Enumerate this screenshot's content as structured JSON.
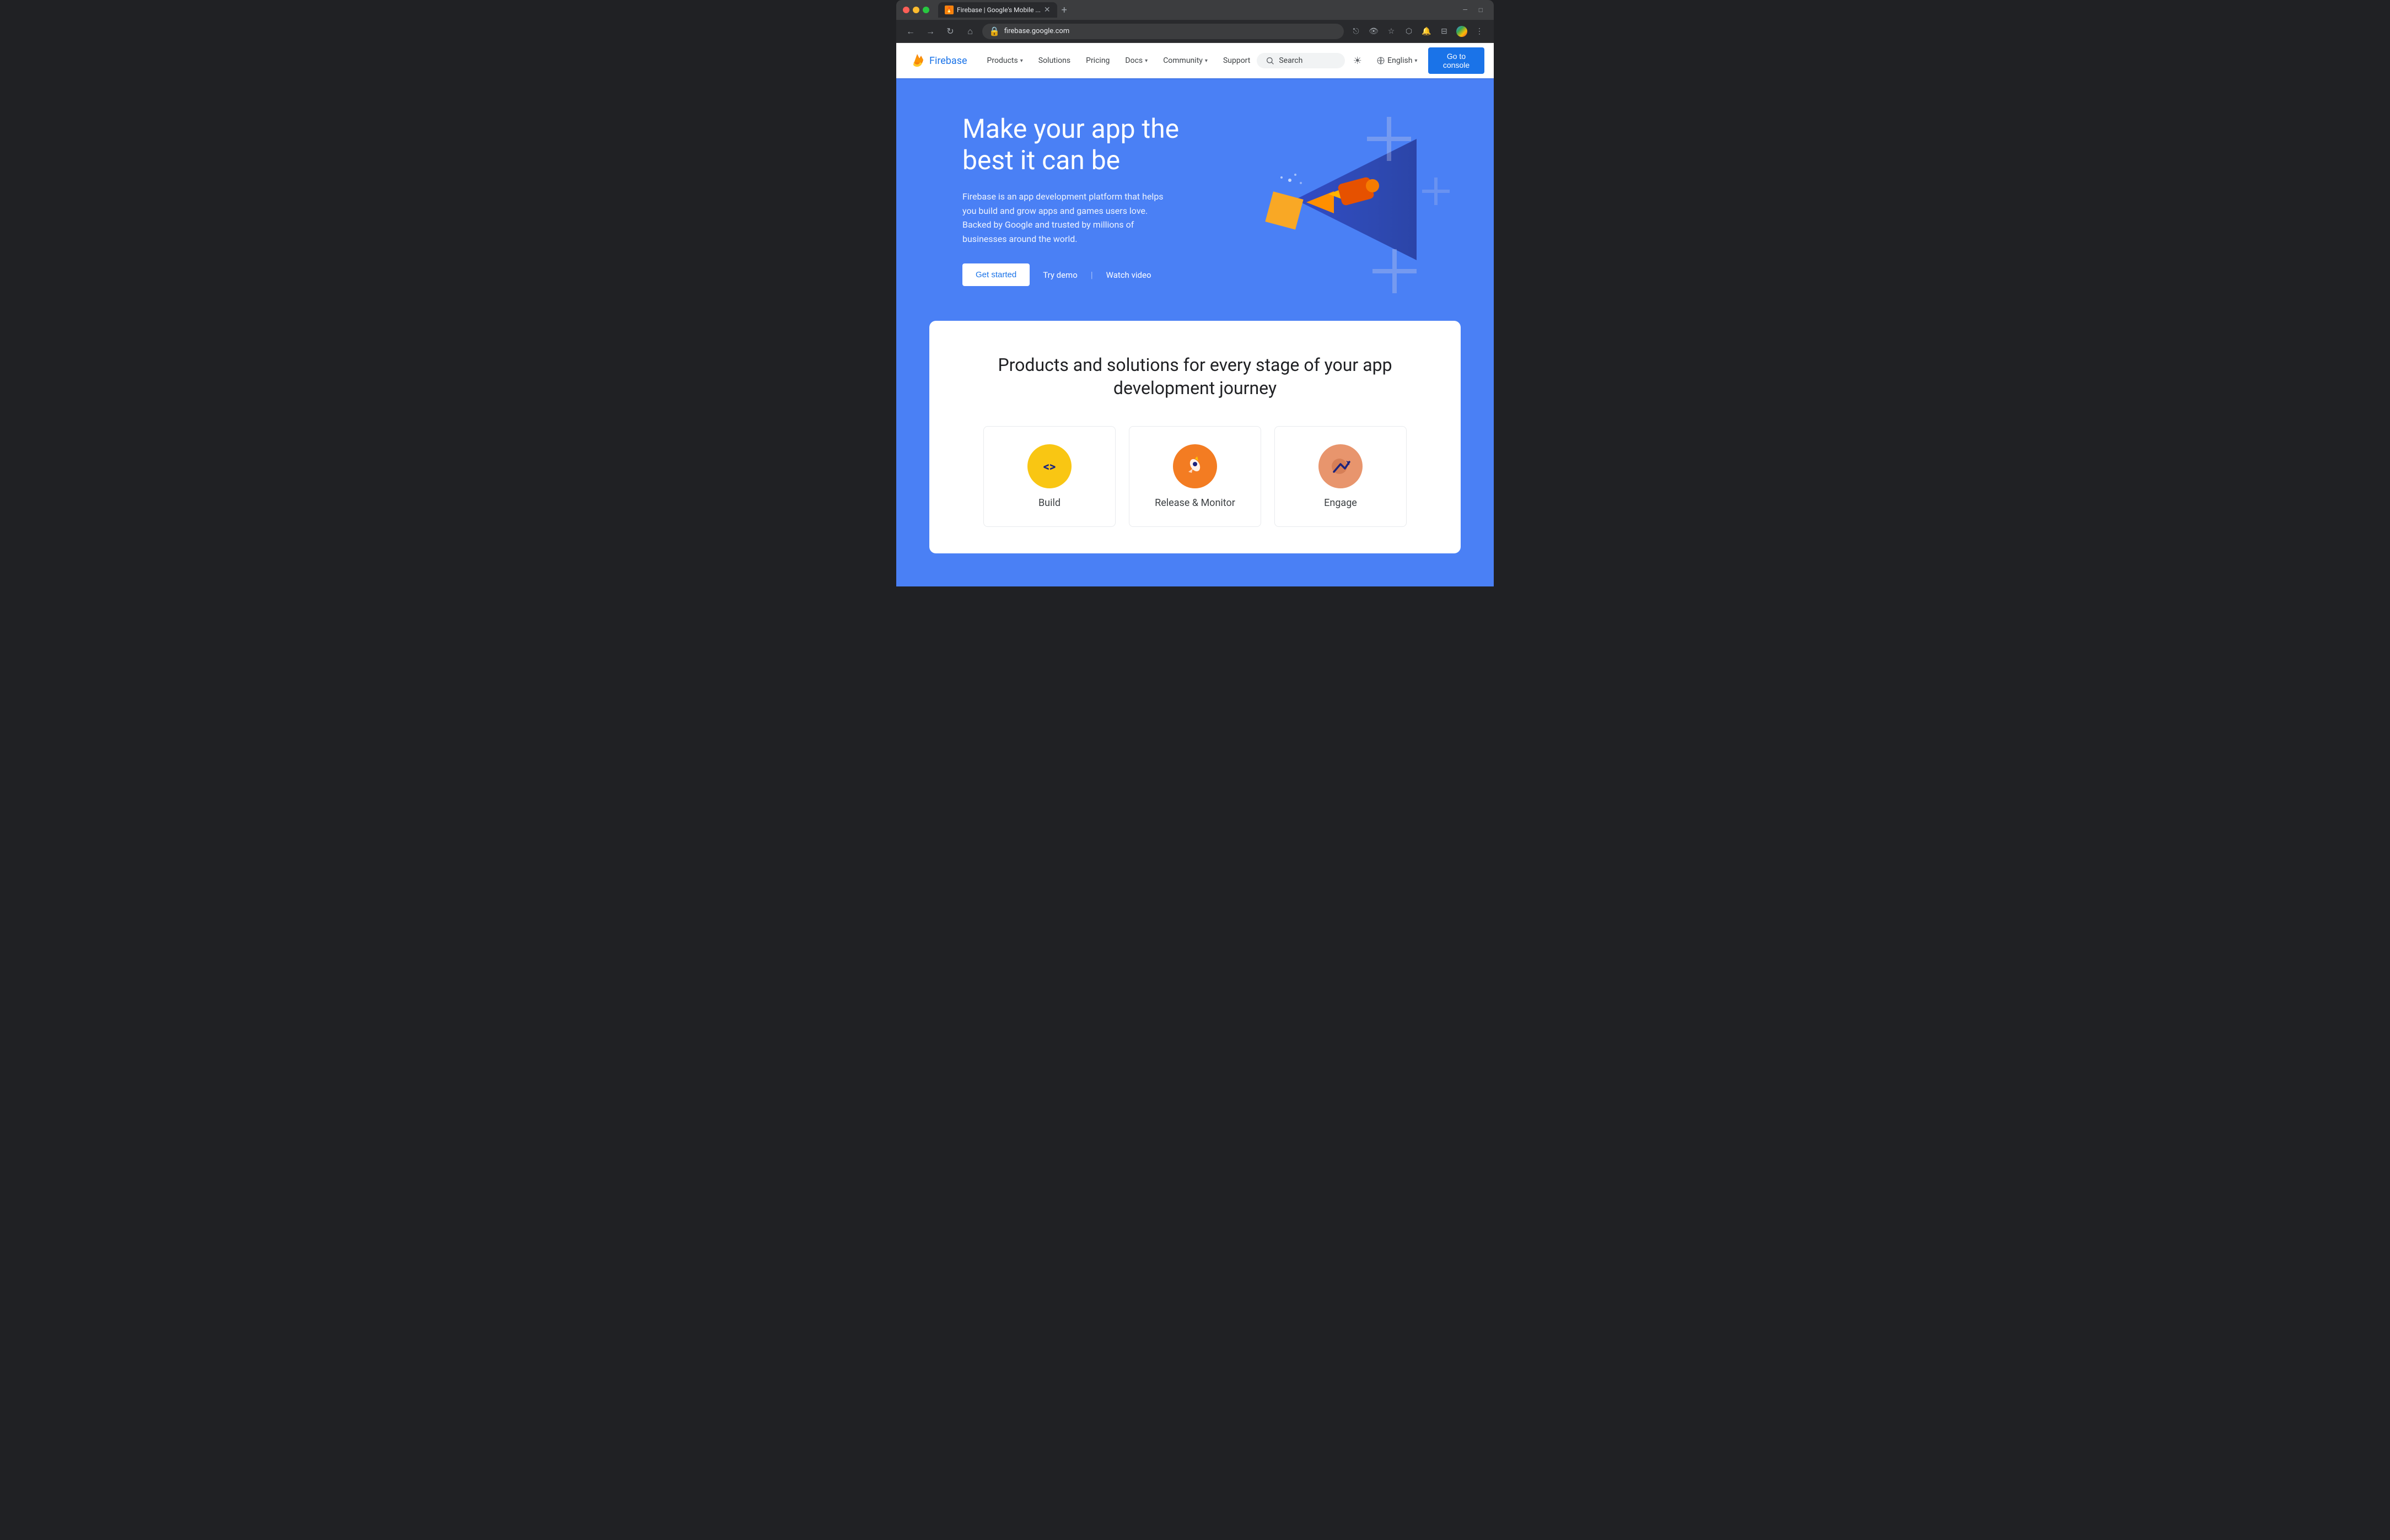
{
  "browser": {
    "tab_title": "Firebase | Google's Mobile ...",
    "tab_favicon": "🔥",
    "url": "firebase.google.com",
    "new_tab_label": "+",
    "nav_back": "←",
    "nav_forward": "→",
    "nav_refresh": "↻",
    "nav_home": "⌂"
  },
  "nav": {
    "logo_text": "Firebase",
    "links": [
      {
        "label": "Products",
        "has_arrow": true
      },
      {
        "label": "Solutions",
        "has_arrow": false
      },
      {
        "label": "Pricing",
        "has_arrow": false
      },
      {
        "label": "Docs",
        "has_arrow": true
      },
      {
        "label": "Community",
        "has_arrow": true
      },
      {
        "label": "Support",
        "has_arrow": false
      }
    ],
    "search_placeholder": "Search",
    "theme_icon": "☀",
    "language": "English",
    "console_btn": "Go to console",
    "more_icon": "⋮"
  },
  "hero": {
    "title": "Make your app the best it can be",
    "subtitle": "Firebase is an app development platform that helps you build and grow apps and games users love. Backed by Google and trusted by millions of businesses around the world.",
    "btn_get_started": "Get started",
    "link_try_demo": "Try demo",
    "link_watch_video": "Watch video"
  },
  "products_section": {
    "title": "Products and solutions for every stage of your app development journey",
    "cards": [
      {
        "name": "Build",
        "icon": "<>",
        "icon_bg": "build"
      },
      {
        "name": "Release & Monitor",
        "icon": "🚀",
        "icon_bg": "release"
      },
      {
        "name": "Engage",
        "icon": "📈",
        "icon_bg": "engage"
      }
    ]
  },
  "colors": {
    "hero_bg": "#4a80f5",
    "nav_bg": "#ffffff",
    "accent_blue": "#1a73e8",
    "products_card_bg": "#ffffff"
  }
}
